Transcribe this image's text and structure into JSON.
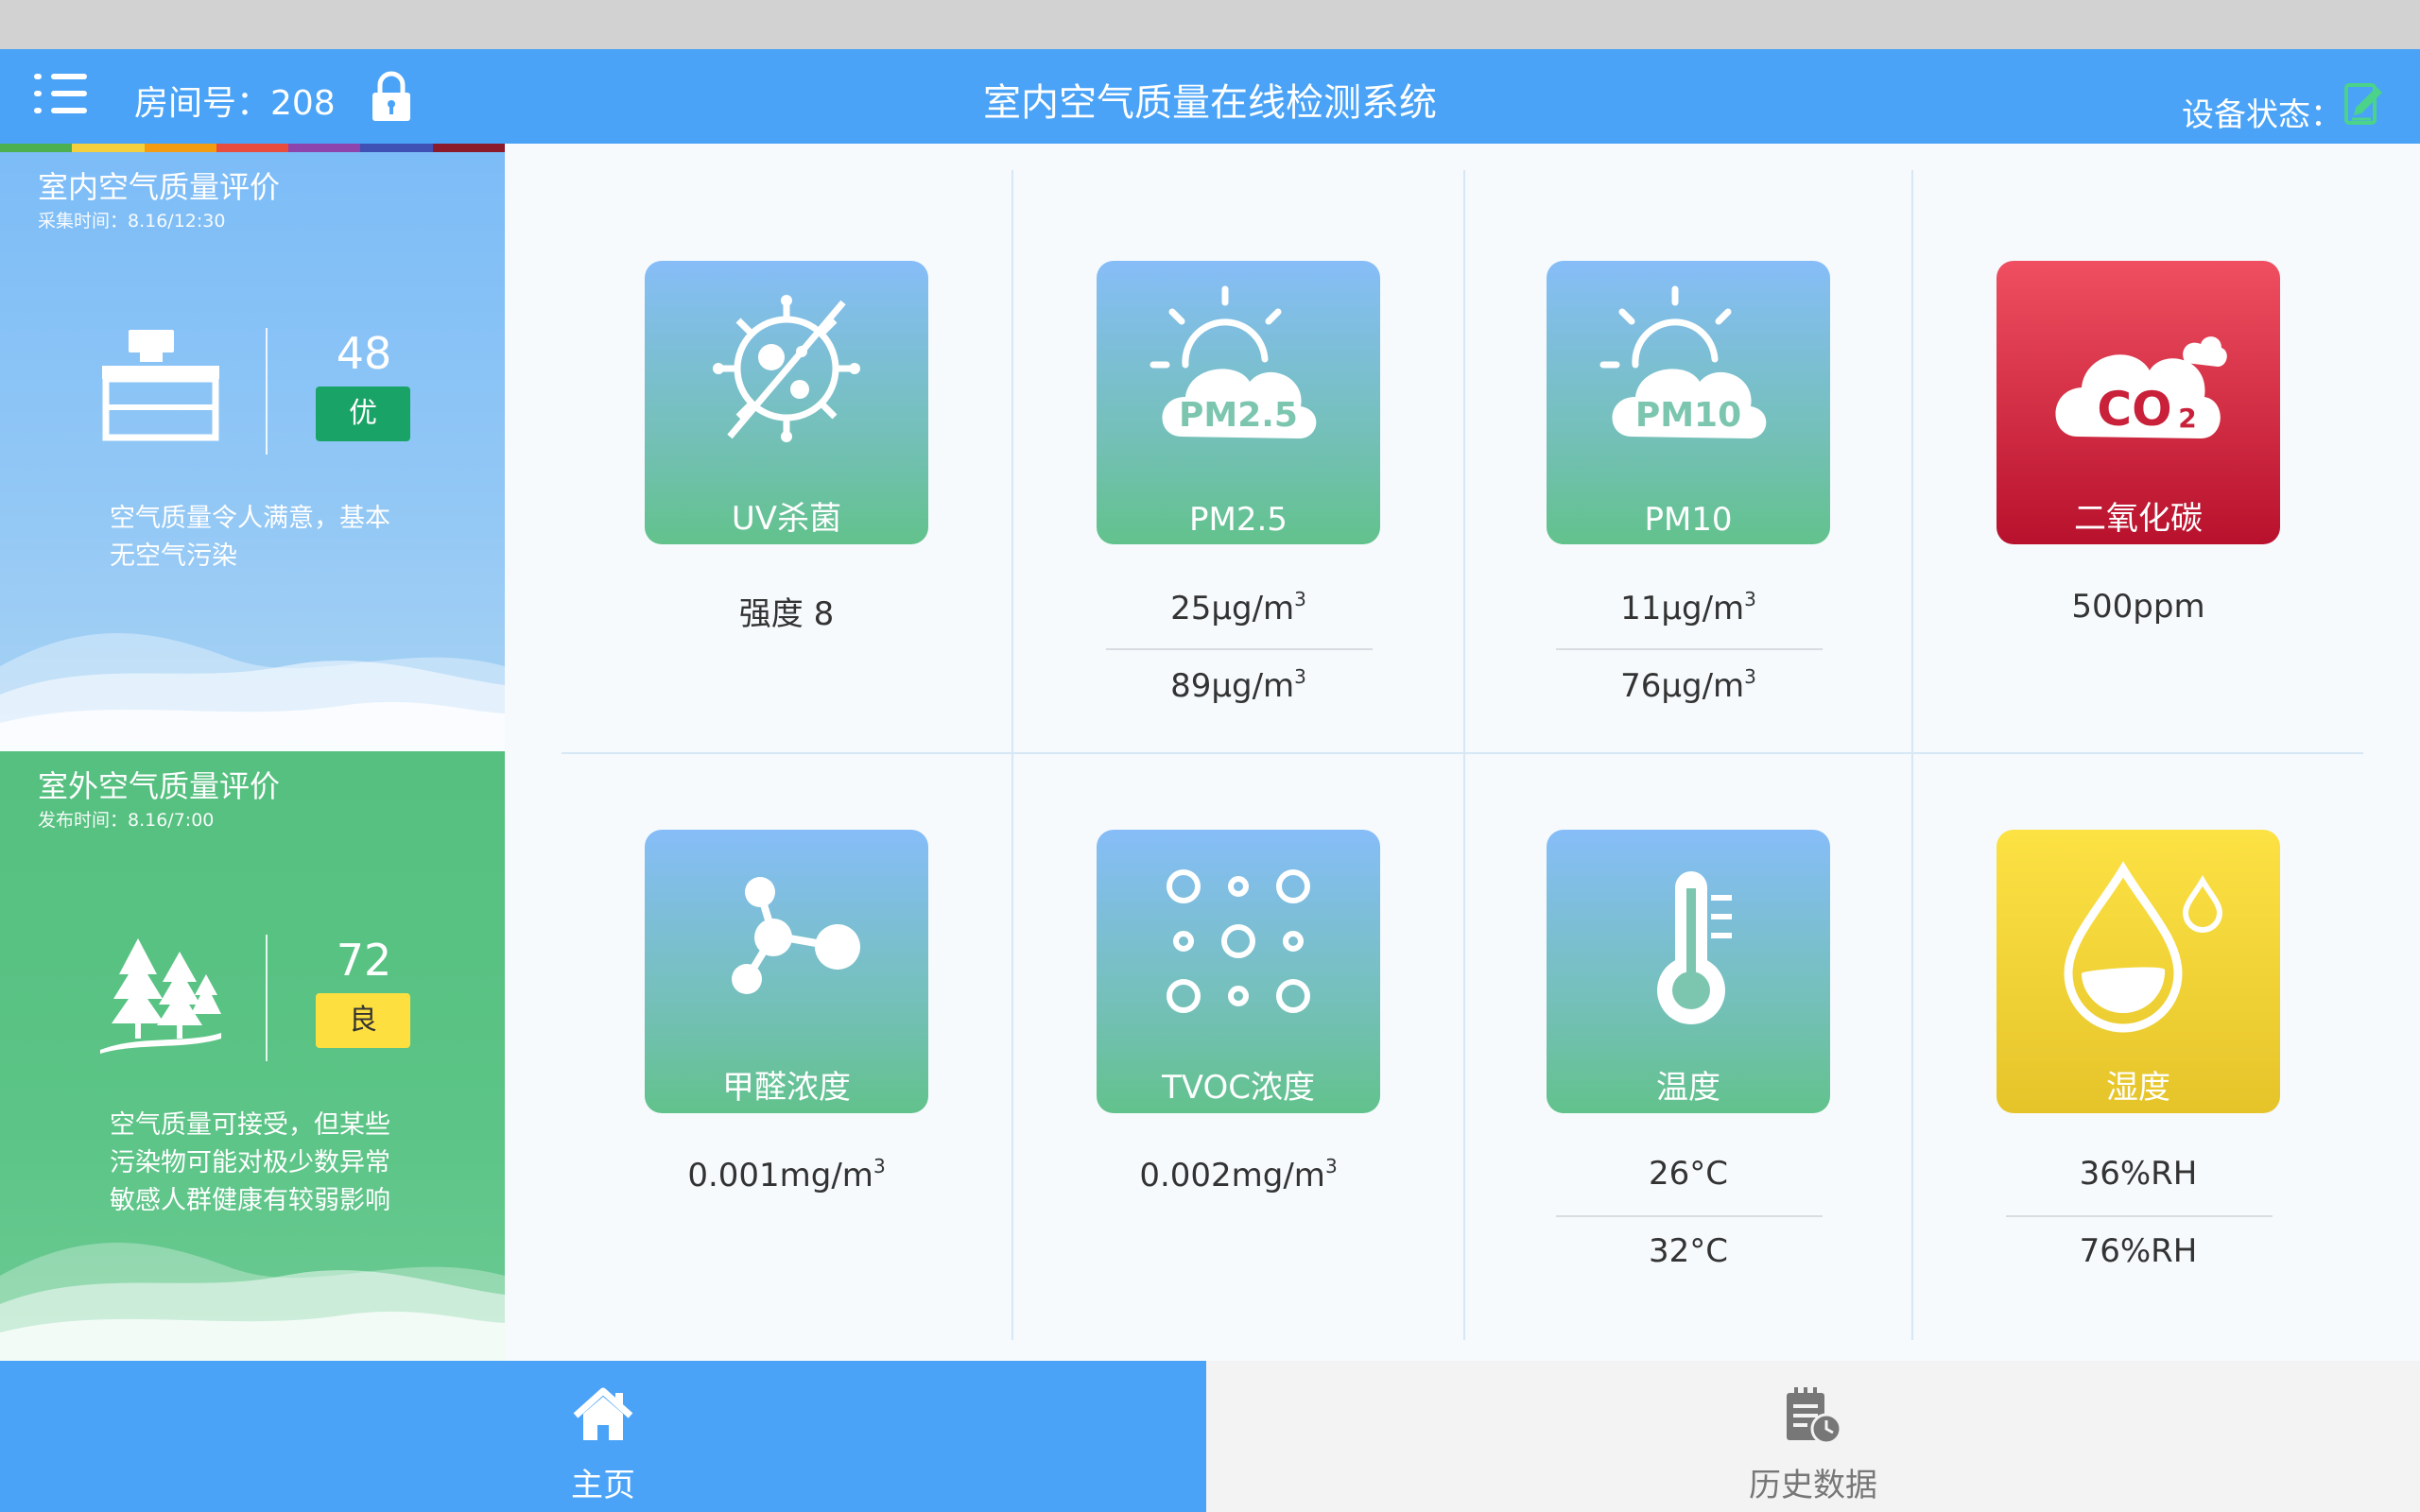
{
  "header": {
    "room_label": "房间号：208",
    "title": "室内空气质量在线检测系统",
    "device_status_label": "设备状态："
  },
  "rainbow_colors": [
    "#4caf50",
    "#f4d03f",
    "#f39c12",
    "#e74c3c",
    "#8e44ad",
    "#3f51b5",
    "#8b1a2b"
  ],
  "indoor": {
    "title": "室内空气质量评价",
    "subtitle": "采集时间：8.16/12:30",
    "score": "48",
    "grade": "优",
    "desc_line1": "空气质量令人满意，基本",
    "desc_line2": "无空气污染"
  },
  "outdoor": {
    "title": "室外空气质量评价",
    "subtitle": "发布时间：8.16/7:00",
    "score": "72",
    "grade": "良",
    "desc_line1": "空气质量可接受，但某些",
    "desc_line2": "污染物可能对极少数异常",
    "desc_line3": "敏感人群健康有较弱影响"
  },
  "cards": {
    "uv": {
      "label": "UV杀菌",
      "value1": "强度 8"
    },
    "pm25": {
      "label": "PM2.5",
      "icon_text": "PM2.5",
      "value1": "25μg/m",
      "value2": "89μg/m",
      "sup": "3"
    },
    "pm10": {
      "label": "PM10",
      "icon_text": "PM10",
      "value1": "11μg/m",
      "value2": "76μg/m",
      "sup": "3"
    },
    "co2": {
      "label": "二氧化碳",
      "icon_text": "CO",
      "icon_sub": "2",
      "value1": "500ppm"
    },
    "hcho": {
      "label": "甲醛浓度",
      "value1": "0.001mg/m",
      "sup": "3"
    },
    "tvoc": {
      "label": "TVOC浓度",
      "value1": "0.002mg/m",
      "sup": "3"
    },
    "temp": {
      "label": "温度",
      "value1": "26°C",
      "value2": "32°C"
    },
    "humidity": {
      "label": "湿度",
      "value1": "36%RH",
      "value2": "76%RH"
    }
  },
  "nav": {
    "home_label": "主页",
    "history_label": "历史数据"
  },
  "icons": {
    "menu": "menu-icon",
    "lock": "lock-icon",
    "device": "device-status-icon",
    "home": "home-icon",
    "history": "history-icon"
  }
}
